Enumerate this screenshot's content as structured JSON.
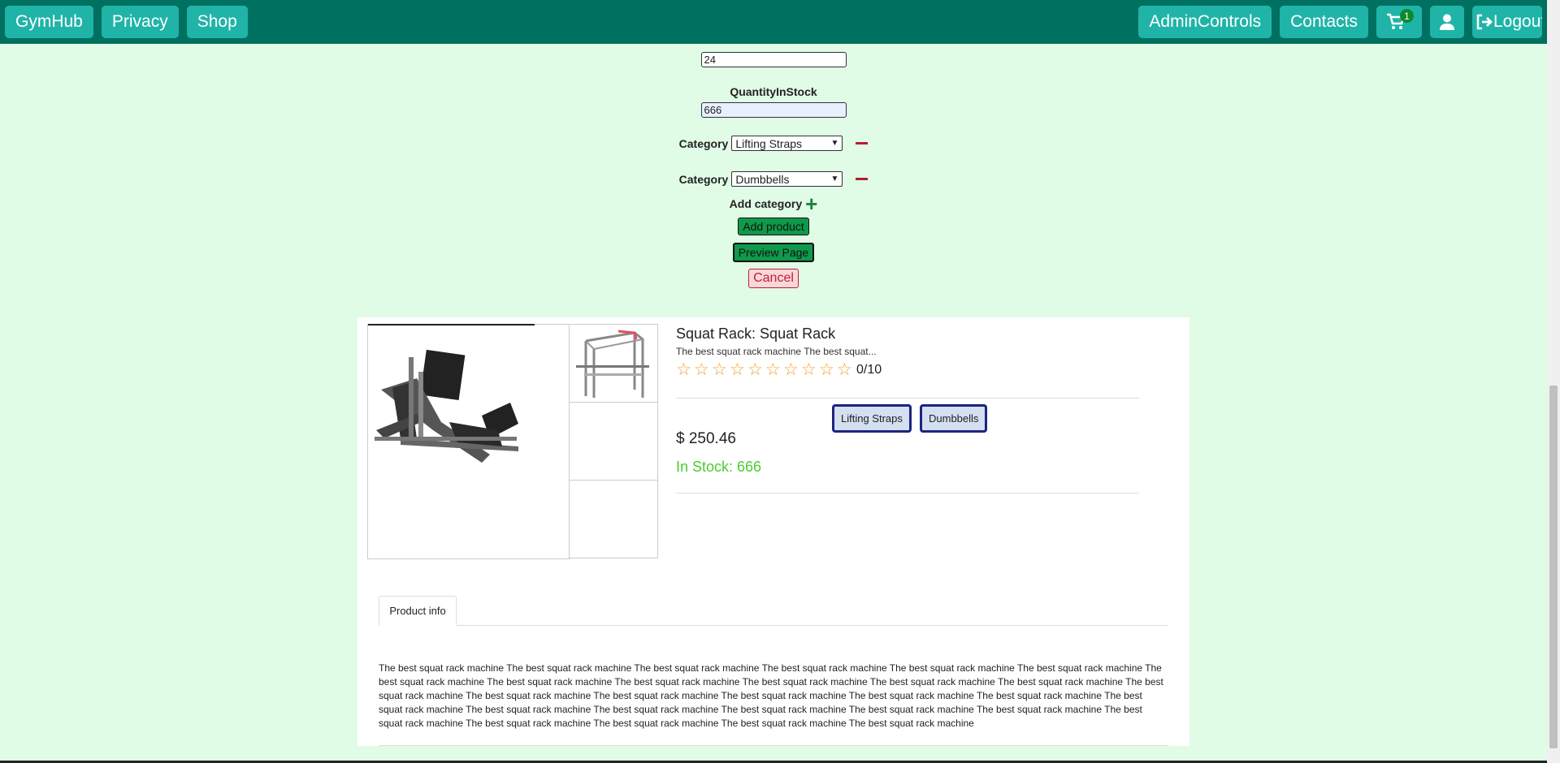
{
  "nav": {
    "brand": "GymHub",
    "privacy": "Privacy",
    "shop": "Shop",
    "admin": "AdminControls",
    "contacts": "Contacts",
    "cart_count": "1",
    "logout": "Logout"
  },
  "form": {
    "hidden_field_value": "24",
    "quantity_label": "QuantityInStock",
    "quantity_value": "666",
    "category_label": "Category",
    "categories": [
      {
        "selected": "Lifting Straps"
      },
      {
        "selected": "Dumbbells"
      }
    ],
    "add_category_label": "Add category",
    "add_product_label": "Add product",
    "preview_label": "Preview Page",
    "cancel_label": "Cancel"
  },
  "preview": {
    "title": "Squat Rack: Squat Rack",
    "short_desc": "The best squat rack machine The best squat...",
    "rating_text": "0/10",
    "stars_count": 10,
    "price": "$ 250.46",
    "stock": "In Stock: 666",
    "chips": [
      "Lifting Straps",
      "Dumbbells"
    ],
    "tab_label": "Product info",
    "long_desc": "The best squat rack machine The best squat rack machine The best squat rack machine The best squat rack machine The best squat rack machine The best squat rack machine The best squat rack machine The best squat rack machine The best squat rack machine The best squat rack machine The best squat rack machine The best squat rack machine The best squat rack machine The best squat rack machine The best squat rack machine The best squat rack machine The best squat rack machine The best squat rack machine The best squat rack machine The best squat rack machine The best squat rack machine The best squat rack machine The best squat rack machine The best squat rack machine The best squat rack machine The best squat rack machine The best squat rack machine The best squat rack machine The best squat rack machine"
  },
  "colors": {
    "navbar": "#007060",
    "nav_button": "#20b4a8",
    "page_bg": "#e0fbe6",
    "stock_green": "#4ccc30",
    "star": "#f0a020"
  }
}
